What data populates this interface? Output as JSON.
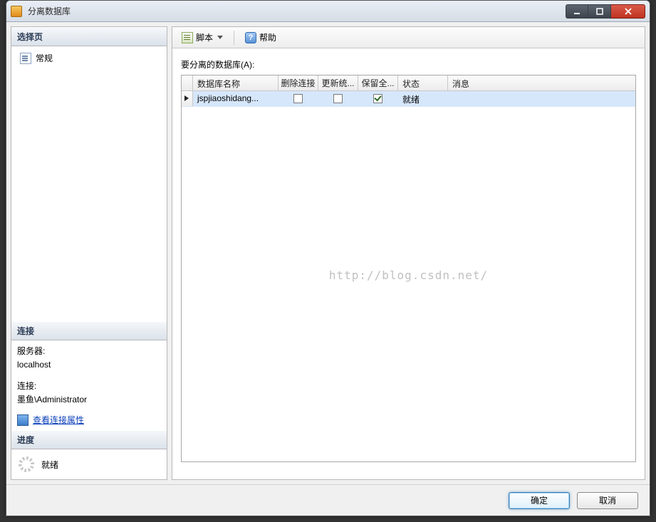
{
  "window": {
    "title": "分离数据库"
  },
  "sidebar": {
    "select_header": "选择页",
    "general_label": "常规",
    "connection_header": "连接",
    "server_label": "服务器:",
    "server_value": "localhost",
    "conn_label": "连接:",
    "conn_value": "墨鱼\\Administrator",
    "view_props": "查看连接属性",
    "progress_header": "进度",
    "progress_status": "就绪"
  },
  "toolbar": {
    "script_label": "脚本",
    "help_label": "帮助"
  },
  "main": {
    "grid_label": "要分离的数据库(A):",
    "columns": {
      "name": "数据库名称",
      "drop": "删除连接",
      "update": "更新统...",
      "keep": "保留全...",
      "status": "状态",
      "message": "消息"
    },
    "row": {
      "name": "jspjiaoshidang...",
      "drop_checked": false,
      "update_checked": false,
      "keep_checked": true,
      "status": "就绪",
      "message": ""
    }
  },
  "watermark": "http://blog.csdn.net/",
  "footer": {
    "ok": "确定",
    "cancel": "取消"
  }
}
